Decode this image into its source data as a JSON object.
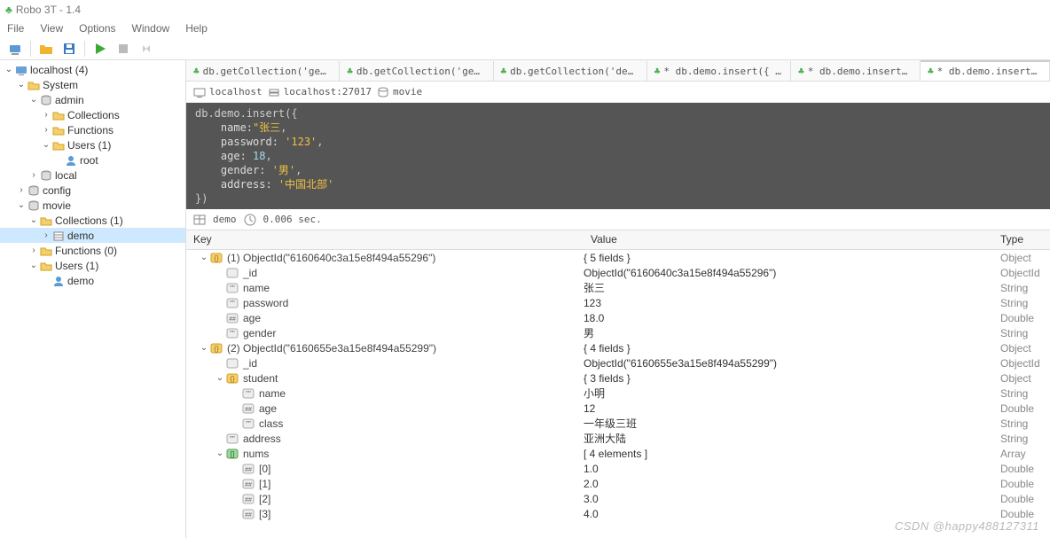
{
  "titlebar": {
    "app": "Robo 3T - 1.4"
  },
  "menubar": {
    "file": "File",
    "view": "View",
    "options": "Options",
    "window": "Window",
    "help": "Help"
  },
  "sidebar": {
    "rows": [
      {
        "indent": 0,
        "toggle": "v",
        "icon": "host",
        "label": "localhost (4)"
      },
      {
        "indent": 1,
        "toggle": "v",
        "icon": "folder",
        "label": "System"
      },
      {
        "indent": 2,
        "toggle": "v",
        "icon": "db",
        "label": "admin"
      },
      {
        "indent": 3,
        "toggle": ">",
        "icon": "folder",
        "label": "Collections"
      },
      {
        "indent": 3,
        "toggle": ">",
        "icon": "folder",
        "label": "Functions"
      },
      {
        "indent": 3,
        "toggle": "v",
        "icon": "folder",
        "label": "Users (1)"
      },
      {
        "indent": 4,
        "toggle": "",
        "icon": "user",
        "label": "root"
      },
      {
        "indent": 2,
        "toggle": ">",
        "icon": "db",
        "label": "local"
      },
      {
        "indent": 1,
        "toggle": ">",
        "icon": "db",
        "label": "config"
      },
      {
        "indent": 1,
        "toggle": "v",
        "icon": "db",
        "label": "movie"
      },
      {
        "indent": 2,
        "toggle": "v",
        "icon": "folder",
        "label": "Collections (1)"
      },
      {
        "indent": 3,
        "toggle": ">",
        "icon": "coll",
        "label": "demo",
        "selected": true
      },
      {
        "indent": 2,
        "toggle": ">",
        "icon": "folder",
        "label": "Functions (0)"
      },
      {
        "indent": 2,
        "toggle": "v",
        "icon": "folder",
        "label": "Users (1)"
      },
      {
        "indent": 3,
        "toggle": "",
        "icon": "user",
        "label": "demo"
      }
    ]
  },
  "tabs": [
    {
      "label": "db.getCollection('genre'···",
      "active": false
    },
    {
      "label": "db.getCollection('genre'···",
      "active": false
    },
    {
      "label": "db.getCollection('demo')···",
      "active": false
    },
    {
      "label": "* db.demo.insert({   'st···",
      "active": false
    },
    {
      "label": "* db.demo.insert(      {···",
      "active": false
    },
    {
      "label": "* db.demo.insert(      {···",
      "active": true
    }
  ],
  "context": {
    "host": "localhost",
    "conn": "localhost:27017",
    "db": "movie"
  },
  "editor": {
    "l0a": "db.demo.insert({",
    "l1a": "    name:",
    "l1b": "\"张三",
    "l1c": ",",
    "l2a": "    password: ",
    "l2b": "'123'",
    "l2c": ",",
    "l3a": "    age: ",
    "l3b": "18",
    "l3c": ",",
    "l4a": "    gender: ",
    "l4b": "'男'",
    "l4c": ",",
    "l5a": "    address: ",
    "l5b": "'中国北部'",
    "l6a": "})"
  },
  "status": {
    "coll": "demo",
    "time": "0.006 sec."
  },
  "grid": {
    "headers": {
      "key": "Key",
      "value": "Value",
      "type": "Type"
    },
    "rows": [
      {
        "indent": 0,
        "toggle": "v",
        "icon": "obj",
        "key": "(1) ObjectId(\"6160640c3a15e8f494a55296\")",
        "value": "{ 5 fields }",
        "type": "Object"
      },
      {
        "indent": 1,
        "toggle": "",
        "icon": "id",
        "key": "_id",
        "value": "ObjectId(\"6160640c3a15e8f494a55296\")",
        "type": "ObjectId"
      },
      {
        "indent": 1,
        "toggle": "",
        "icon": "str",
        "key": "name",
        "value": "张三",
        "type": "String"
      },
      {
        "indent": 1,
        "toggle": "",
        "icon": "str",
        "key": "password",
        "value": "123",
        "type": "String"
      },
      {
        "indent": 1,
        "toggle": "",
        "icon": "num",
        "key": "age",
        "value": "18.0",
        "type": "Double"
      },
      {
        "indent": 1,
        "toggle": "",
        "icon": "str",
        "key": "gender",
        "value": "男",
        "type": "String"
      },
      {
        "indent": 0,
        "toggle": "v",
        "icon": "obj",
        "key": "(2) ObjectId(\"6160655e3a15e8f494a55299\")",
        "value": "{ 4 fields }",
        "type": "Object"
      },
      {
        "indent": 1,
        "toggle": "",
        "icon": "id",
        "key": "_id",
        "value": "ObjectId(\"6160655e3a15e8f494a55299\")",
        "type": "ObjectId"
      },
      {
        "indent": 1,
        "toggle": "v",
        "icon": "obj",
        "key": "student",
        "value": "{ 3 fields }",
        "type": "Object"
      },
      {
        "indent": 2,
        "toggle": "",
        "icon": "str",
        "key": "name",
        "value": "小明",
        "type": "String"
      },
      {
        "indent": 2,
        "toggle": "",
        "icon": "num",
        "key": "age",
        "value": "12",
        "type": "Double"
      },
      {
        "indent": 2,
        "toggle": "",
        "icon": "str",
        "key": "class",
        "value": "一年级三班",
        "type": "String"
      },
      {
        "indent": 1,
        "toggle": "",
        "icon": "str",
        "key": "address",
        "value": "亚洲大陆",
        "type": "String"
      },
      {
        "indent": 1,
        "toggle": "v",
        "icon": "arr",
        "key": "nums",
        "value": "[ 4 elements ]",
        "type": "Array"
      },
      {
        "indent": 2,
        "toggle": "",
        "icon": "num",
        "key": "[0]",
        "value": "1.0",
        "type": "Double"
      },
      {
        "indent": 2,
        "toggle": "",
        "icon": "num",
        "key": "[1]",
        "value": "2.0",
        "type": "Double"
      },
      {
        "indent": 2,
        "toggle": "",
        "icon": "num",
        "key": "[2]",
        "value": "3.0",
        "type": "Double"
      },
      {
        "indent": 2,
        "toggle": "",
        "icon": "num",
        "key": "[3]",
        "value": "4.0",
        "type": "Double"
      }
    ]
  },
  "watermark": "CSDN @happy488127311"
}
